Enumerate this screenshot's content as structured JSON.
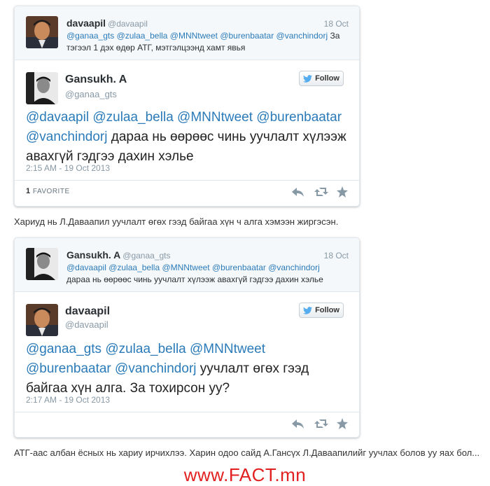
{
  "tweet1": {
    "reply": {
      "name": "davaapil",
      "handle": "@davaapil",
      "date": "18 Oct",
      "mentions": "@ganaa_gts @zulaa_bella @MNNtweet @burenbaatar @vanchindorj",
      "text_rest": " За тэгээл 1 дэх өдөр АТГ, мэтгэлцээнд хамт явья"
    },
    "main": {
      "name": "Gansukh. A",
      "handle": "@ganaa_gts",
      "follow_label": "Follow",
      "mentions": "@davaapil @zulaa_bella @MNNtweet @burenbaatar @vanchindorj",
      "text_rest": " дараа нь өөрөөс чинь уучлалт хүлээж авахгүй гэдгээ дахин хэлье",
      "timestamp": "2:15 AM - 19 Oct 2013",
      "fav_count": "1",
      "fav_label": "FAVORITE"
    }
  },
  "caption1": "Хариуд нь Л.Даваапил уучлалт өгөх гээд байгаа хүн ч алга хэмээн жиргэсэн.",
  "tweet2": {
    "reply": {
      "name": "Gansukh. A",
      "handle": "@ganaa_gts",
      "date": "18 Oct",
      "mentions": "@davaapil @zulaa_bella @MNNtweet @burenbaatar @vanchindorj",
      "text_rest": "дараа нь өөрөөс чинь уучлалт хүлээж авахгүй гэдгээ дахин хэлье"
    },
    "main": {
      "name": "davaapil",
      "handle": "@davaapil",
      "follow_label": "Follow",
      "mentions": "@ganaa_gts @zulaa_bella @MNNtweet @burenbaatar @vanchindorj",
      "text_rest": " уучлалт өгөх гээд байгаа хүн алга. За тохирсон уу?",
      "timestamp": "2:17 AM - 19 Oct 2013"
    }
  },
  "caption2": "АТГ-аас албан ёсных нь хариу ирчихлээ. Харин одоо сайд А.Гансүх Л.Даваапилийг уучлах болов уу яах бол...",
  "watermark": "www.FACT.mn",
  "colors": {
    "mention": "#2b7bb9",
    "watermark": "#e32020",
    "twitter_bird": "#55acee"
  },
  "icons": [
    "twitter-bird-icon",
    "reply-icon",
    "retweet-icon",
    "favorite-star-icon"
  ]
}
